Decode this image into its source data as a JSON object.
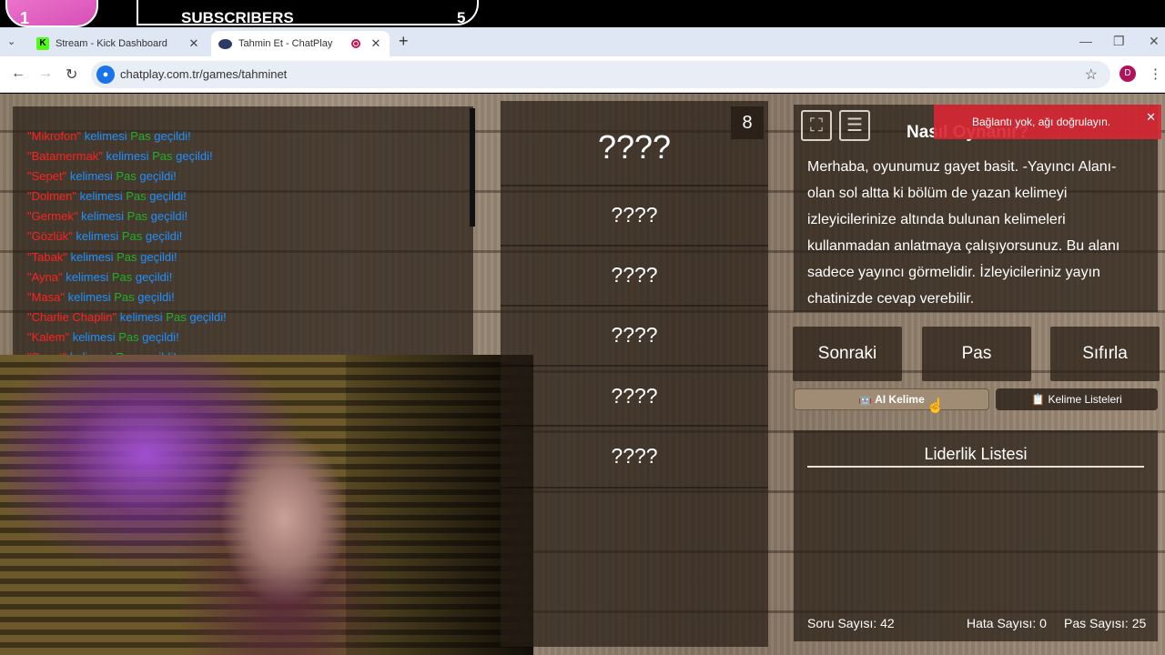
{
  "overlay": {
    "rank": "1",
    "subscribers_label": "SUBSCRIBERS",
    "subscribers_count": "5"
  },
  "browser": {
    "tabs": [
      {
        "title": "Stream - Kick Dashboard",
        "favicon": "kick-icon"
      },
      {
        "title": "Tahmin Et - ChatPlay",
        "favicon": "chatplay-icon",
        "recording": true
      }
    ],
    "url": "chatplay.com.tr/games/tahminet",
    "profile_initial": "D",
    "icons": {
      "back": "←",
      "forward": "→",
      "reload": "↻",
      "star": "☆",
      "menu": "⋮",
      "new_tab": "+",
      "close": "✕",
      "tab_list": "⌄",
      "minimize": "—",
      "restore": "❐",
      "window_close": "✕",
      "mic": "🎙"
    }
  },
  "chat": {
    "lines": [
      {
        "word": "\"Mikrofon\"",
        "text": " kelimesi ",
        "status": "Pas",
        "suffix": " geçildi!"
      },
      {
        "word": "\"Batamermak\"",
        "text": " kelimesi ",
        "status": "Pas",
        "suffix": " geçildi!"
      },
      {
        "word": "\"Sepet\"",
        "text": " kelimesi ",
        "status": "Pas",
        "suffix": " geçildi!"
      },
      {
        "word": "\"Dolmen\"",
        "text": " kelimesi ",
        "status": "Pas",
        "suffix": " geçildi!"
      },
      {
        "word": "\"Germek\"",
        "text": " kelimesi ",
        "status": "Pas",
        "suffix": " geçildi!"
      },
      {
        "word": "\"Gözlük\"",
        "text": " kelimesi ",
        "status": "Pas",
        "suffix": " geçildi!"
      },
      {
        "word": "\"Tabak\"",
        "text": " kelimesi ",
        "status": "Pas",
        "suffix": " geçildi!"
      },
      {
        "word": "\"Ayna\"",
        "text": " kelimesi ",
        "status": "Pas",
        "suffix": " geçildi!"
      },
      {
        "word": "\"Masa\"",
        "text": " kelimesi ",
        "status": "Pas",
        "suffix": " geçildi!"
      },
      {
        "word": "\"Charlie Chaplin\"",
        "text": " kelimesi ",
        "status": "Pas",
        "suffix": " geçildi!"
      },
      {
        "word": "\"Kalem\"",
        "text": " kelimesi ",
        "status": "Pas",
        "suffix": " geçildi!"
      },
      {
        "word": "\"Sepet\"",
        "text": " kelimesi ",
        "status": "Pas",
        "suffix": " geçildi!"
      }
    ]
  },
  "words": {
    "count": "8",
    "main": "????",
    "forbidden": [
      "????",
      "????",
      "????",
      "????",
      "????"
    ]
  },
  "info": {
    "title": "Nasıl Oynanır?",
    "text": "Merhaba, oyunumuz gayet basit. -Yayıncı Alanı- olan sol altta ki bölüm de yazan kelimeyi izleyicilerinize altında bulunan kelimeleri kullanmadan anlatmaya çalışıyorsunuz. Bu alanı sadece yayıncı görmelidir. İzleyicileriniz yayın chatinizde cevap verebilir."
  },
  "toast": {
    "message": "Bağlantı yok, ağı doğrulayın.",
    "close": "✕"
  },
  "buttons": {
    "next": "Sonraki",
    "pass": "Pas",
    "reset": "Sıfırla",
    "ai_word": "🤖 AI Kelime",
    "word_lists": "📋 Kelime Listeleri"
  },
  "leaderboard": {
    "title": "Liderlik Listesi",
    "questions": "Soru Sayısı: 42",
    "errors": "Hata Sayısı: 0",
    "passes": "Pas Sayısı: 25"
  },
  "colors": {
    "chat_word": "#ff2020",
    "chat_text": "#1e90ff",
    "chat_status": "#1fae2a",
    "toast_bg": "#d62834"
  }
}
